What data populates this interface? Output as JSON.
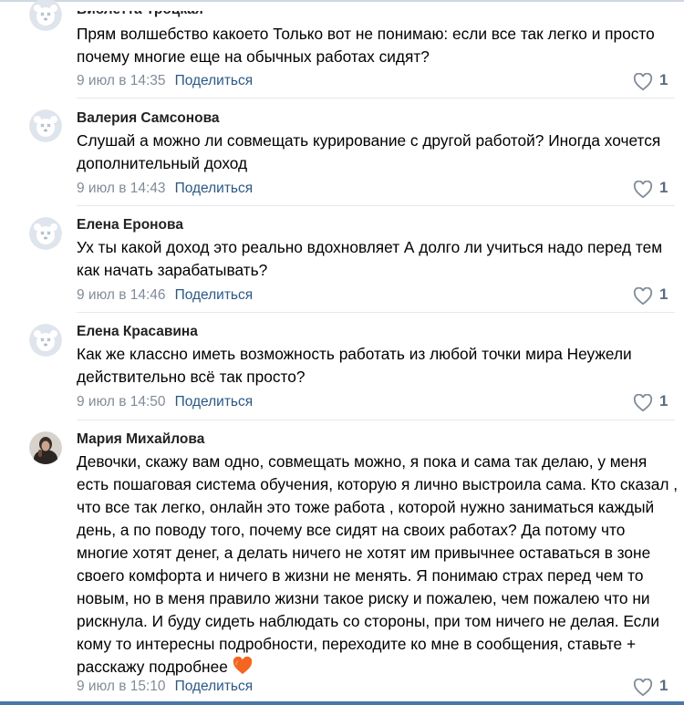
{
  "comments": [
    {
      "author": "Виолетта Троцкая",
      "text": "Прям волшебство какоето Только вот не понимаю: если все так легко и просто почему многие еще на обычных работах сидят?",
      "date": "9 июл в 14:35",
      "share": "Поделиться",
      "likes": "1"
    },
    {
      "author": "Валерия Самсонова",
      "text": "Слушай а можно ли совмещать курирование с другой работой? Иногда хочется дополнительный доход",
      "date": "9 июл в 14:43",
      "share": "Поделиться",
      "likes": "1"
    },
    {
      "author": "Елена Еронова",
      "text": "Ух ты какой доход это реально вдохновляет А долго ли учиться надо перед тем как начать зарабатывать?",
      "date": "9 июл в 14:46",
      "share": "Поделиться",
      "likes": "1"
    },
    {
      "author": "Елена Красавина",
      "text": "Как же классно иметь возможность работать из любой точки мира Неужели действительно всё так просто?",
      "date": "9 июл в 14:50",
      "share": "Поделиться",
      "likes": "1"
    },
    {
      "author": "Мария Михайлова",
      "text": "Девочки, скажу вам одно, совмещать можно, я пока и сама так делаю, у меня есть пошаговая система обучения, которую я лично выстроила сама. Кто сказал , что все так легко, онлайн это тоже работа , которой нужно заниматься каждый день, а по поводу того, почему все сидят на своих работах? Да потому что многие хотят денег, а делать ничего не хотят им привычнее оставаться в зоне своего комфорта и ничего в жизни не менять. Я понимаю страх перед чем то новым, но в меня правило жизни такое риску и пожалею, чем пожалею что ни рискнула. И буду сидеть наблюдать со стороны, при том ничего не делая. Если кому то интересны подробности, переходите ко мне в сообщения, ставьте + расскажу подробнее",
      "date": "9 июл в 15:10",
      "share": "Поделиться",
      "likes": "1"
    }
  ],
  "icons": {
    "default_avatar": "dog-avatar-icon",
    "like": "heart-outline-icon",
    "emoji": "orange-heart-emoji-icon"
  },
  "colors": {
    "link": "#2a5885",
    "meta": "#818c99",
    "avatar_bg": "#dfe5ec",
    "avatar_fg": "#aebccb",
    "emoji": "#f4651f"
  }
}
